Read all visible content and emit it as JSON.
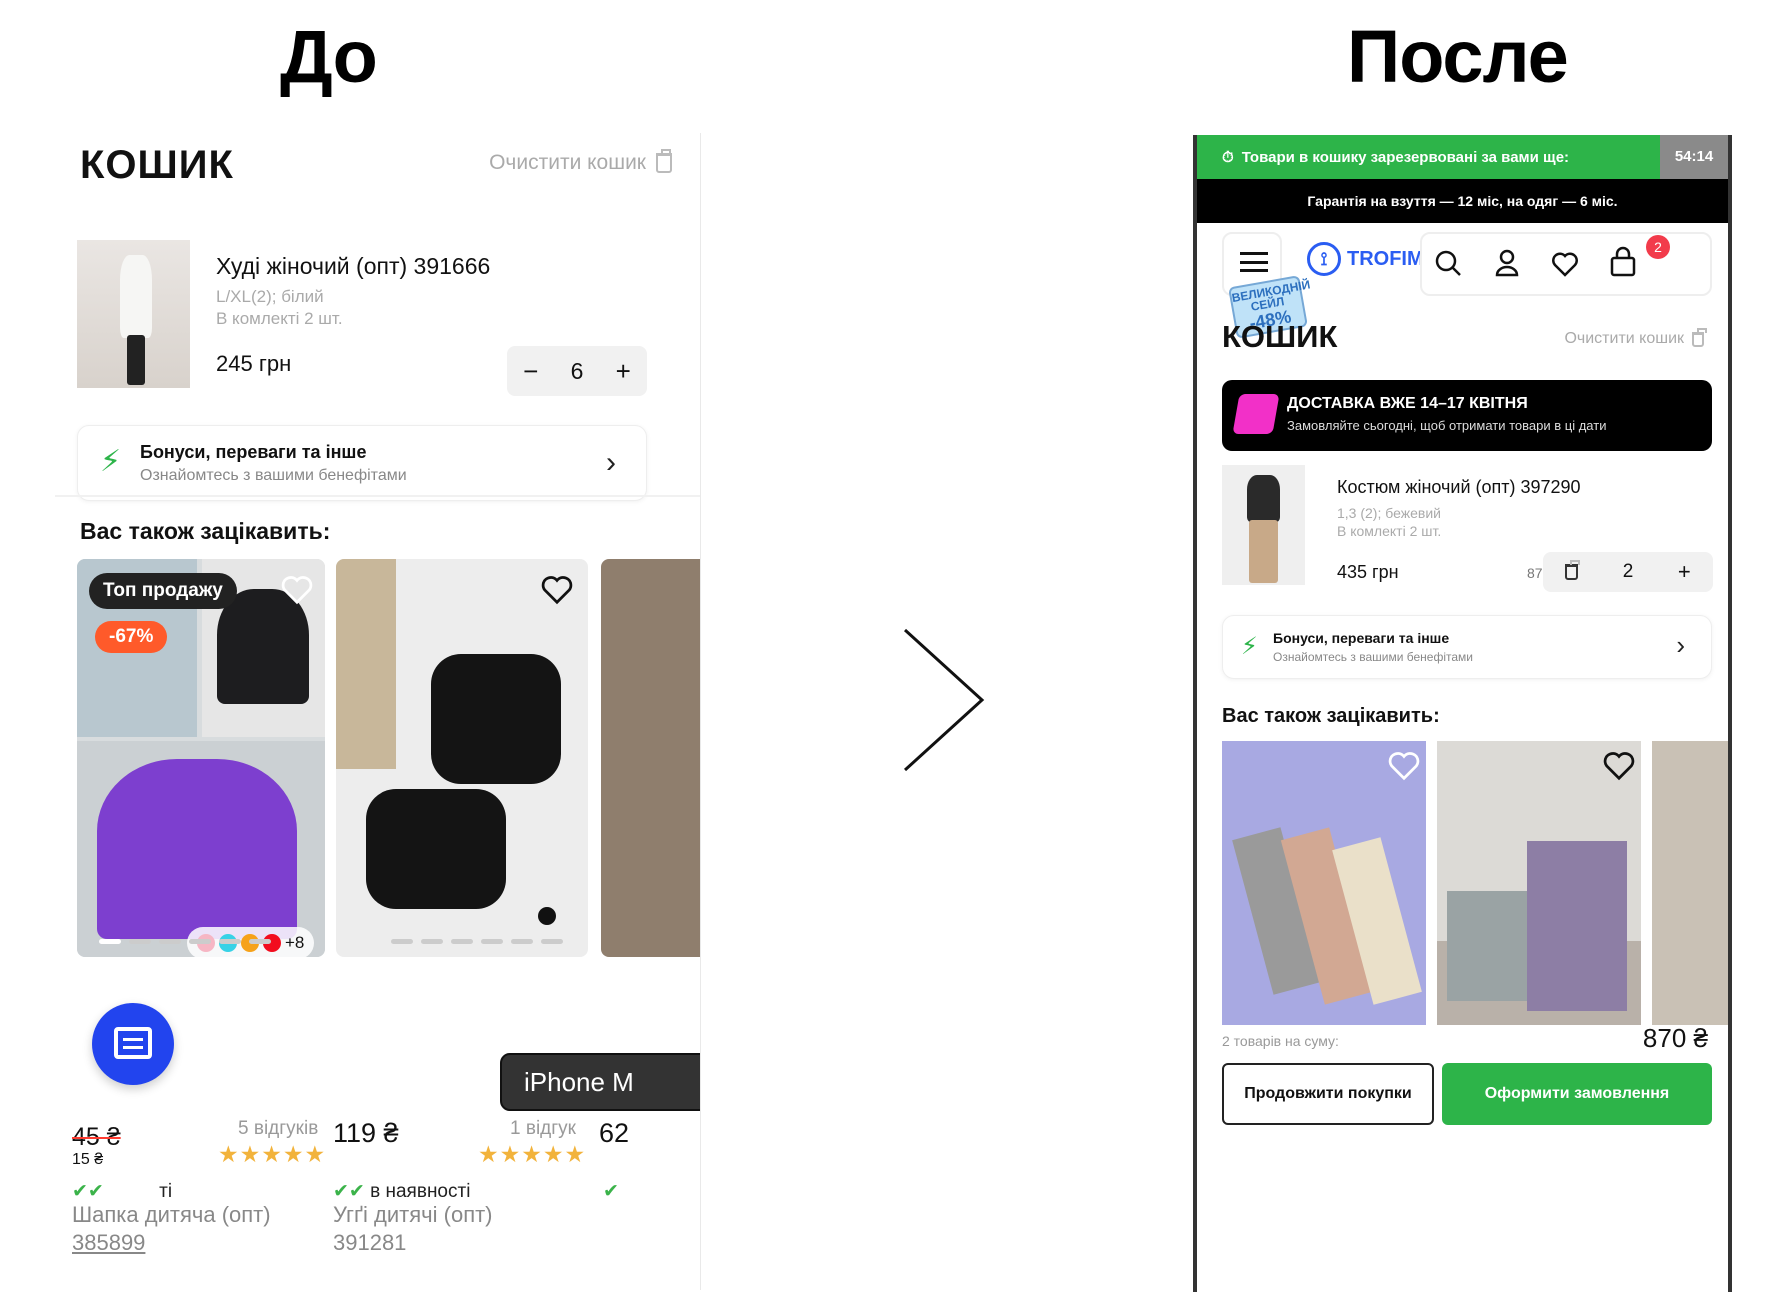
{
  "headings": {
    "before": "До",
    "after": "После"
  },
  "before": {
    "title": "КОШИК",
    "clear_label": "Очистити кошик",
    "item": {
      "name": "Худі жіночий (опт) 391666",
      "variant": "L/XL(2); білий",
      "set": "В комлекті 2 шт.",
      "price": "245 грн",
      "qty": "6"
    },
    "bonus": {
      "title": "Бонуси, переваги та інше",
      "subtitle": "Ознайомтесь з вашими бенефітами"
    },
    "also_title": "Вас також зацікавить:",
    "products": [
      {
        "badge_top": "Топ продажу",
        "badge_discount": "-67%",
        "extra_colors": "+8",
        "old_price": "45 ₴",
        "small_price": "15 ₴",
        "reviews": "5 відгуків",
        "stars": "★★★★★",
        "availability": "ті",
        "name": "Шапка дитяча (опт)",
        "code": "385899"
      },
      {
        "price": "119 ₴",
        "reviews": "1 відгук",
        "stars": "★★★★★",
        "availability": "в наявності",
        "name": "Угґі дитячі (опт)",
        "code": "391281"
      },
      {
        "price_partial": "62"
      }
    ],
    "tooltip": "iPhone M"
  },
  "after": {
    "reserve_text": "Товари в кошику зарезервовані за вами ще:",
    "timer": "54:14",
    "guarantee": "Гарантія на взуття — 12 міс, на одяг — 6 міс.",
    "logo": "TROFIM",
    "sale_tag": {
      "line1": "ВЕЛИКОДНІЙ",
      "line2": "СЕЙЛ",
      "pct": "-48%"
    },
    "cart_count": "2",
    "title": "КОШИК",
    "clear_label": "Очистити кошик",
    "delivery": {
      "title": "ДОСТАВКА ВЖЕ 14–17 КВІТНЯ",
      "subtitle": "Замовляйте сьогодні, щоб отримати товари в ці дати"
    },
    "item": {
      "name": "Костюм жіночий (опт) 397290",
      "variant": "1,3 (2); бежевий",
      "set": "В комлекті 2 шт.",
      "price": "435 грн",
      "unit_price": "870 грн",
      "qty": "2"
    },
    "bonus": {
      "title": "Бонуси, переваги та інше",
      "subtitle": "Ознайомтесь з вашими бенефітами"
    },
    "also_title": "Вас також зацікавить:",
    "sum_label": "2 товарів на суму:",
    "sum_value": "870 ₴",
    "continue_label": "Продовжити покупки",
    "checkout_label": "Оформити замовлення"
  },
  "colors": {
    "green": "#2db449",
    "blue": "#2a5df2",
    "fab": "#2244ee",
    "pink": "#f230c8",
    "red_badge": "#f23b4b",
    "discount": "#ff5a2a",
    "stars": "#f2b33c"
  },
  "icons": [
    "trash-icon",
    "minus-icon",
    "plus-icon",
    "bolt-icon",
    "chevron-right-icon",
    "heart-icon",
    "chat-icon",
    "timer-icon",
    "menu-icon",
    "search-icon",
    "user-icon",
    "cart-icon",
    "truck-icon",
    "arrow-right-icon"
  ]
}
